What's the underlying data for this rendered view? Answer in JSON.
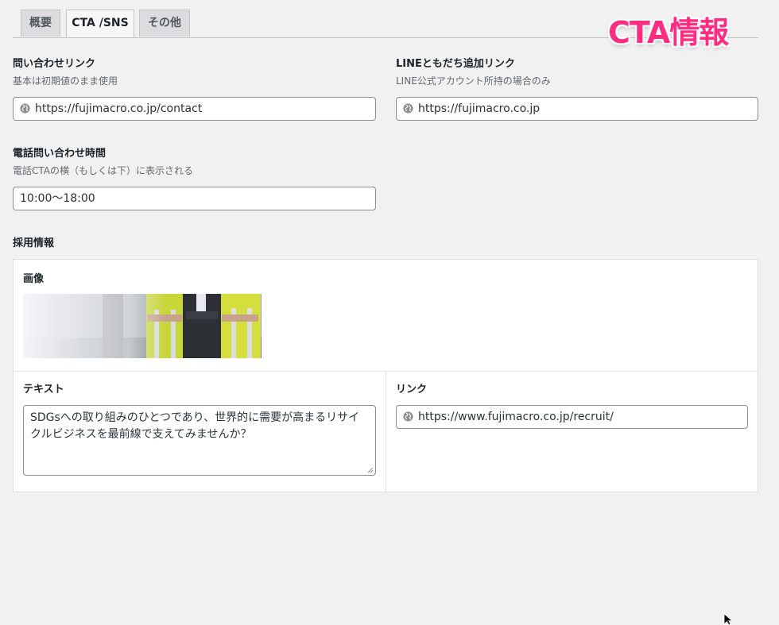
{
  "tabs": [
    {
      "label": "概要",
      "active": false
    },
    {
      "label": "CTA /SNS",
      "active": true
    },
    {
      "label": "その他",
      "active": false
    }
  ],
  "stamp": "CTA情報",
  "contact": {
    "label": "問い合わせリンク",
    "description": "基本は初期値のまま使用",
    "value": "https://fujimacro.co.jp/contact"
  },
  "line": {
    "label": "LINEともだち追加リンク",
    "description": "LINE公式アカウント所持の場合のみ",
    "value": "https://fujimacro.co.jp"
  },
  "phone_hours": {
    "label": "電話問い合わせ時間",
    "description": "電話CTAの横（もしくは下）に表示される",
    "value": "10:00〜18:00"
  },
  "recruit": {
    "section_label": "採用情報",
    "image_label": "画像",
    "text_label": "テキスト",
    "text_value": "SDGsへの取り組みのひとつであり、世界的に需要が高まるリサイクルビジネスを最前線で支えてみませんか？",
    "link_label": "リンク",
    "link_value": "https://www.fujimacro.co.jp/recruit/"
  },
  "icons": {
    "globe": "globe-icon",
    "cursor": "mouse-cursor-icon"
  },
  "colors": {
    "accent_stamp": "#ff2d80",
    "background": "#f1f1f1"
  }
}
